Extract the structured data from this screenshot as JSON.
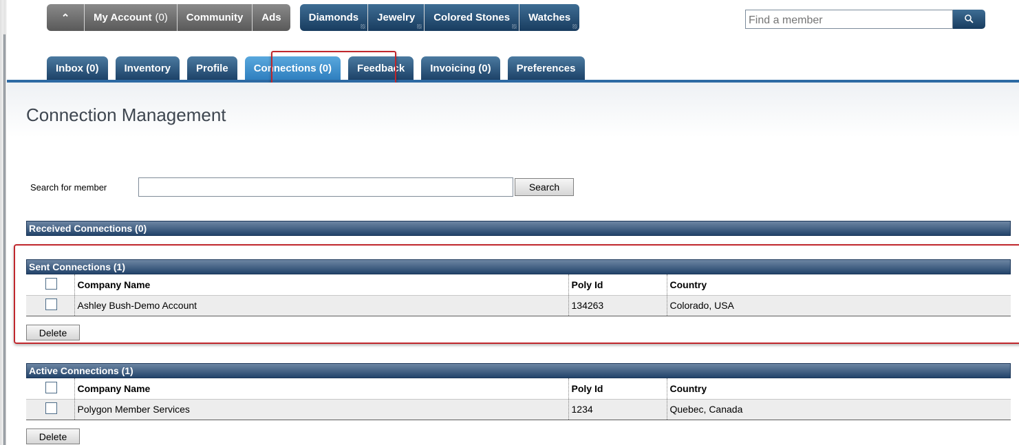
{
  "top_nav": {
    "home_icon": "home-icon",
    "my_account_label": "My Account",
    "my_account_count": "(0)",
    "community_label": "Community",
    "ads_label": "Ads",
    "diamonds_label": "Diamonds",
    "jewelry_label": "Jewelry",
    "colored_stones_label": "Colored Stones",
    "watches_label": "Watches",
    "member_search_placeholder": "Find a member",
    "search_icon": "search-icon"
  },
  "sub_tabs": [
    {
      "label": "Inbox (0)"
    },
    {
      "label": "Inventory"
    },
    {
      "label": "Profile"
    },
    {
      "label": "Connections (0)",
      "active": true
    },
    {
      "label": "Feedback"
    },
    {
      "label": "Invoicing (0)"
    },
    {
      "label": "Preferences"
    }
  ],
  "page": {
    "title": "Connection Management",
    "search_label": "Search for member",
    "search_value": "",
    "search_button": "Search"
  },
  "received": {
    "title": "Received Connections (0)"
  },
  "sent": {
    "title": "Sent Connections (1)",
    "headers": [
      "Company Name",
      "Poly Id",
      "Country"
    ],
    "rows": [
      {
        "company": "Ashley Bush-Demo Account",
        "poly_id": "134263",
        "country": "Colorado, USA"
      }
    ],
    "delete_label": "Delete"
  },
  "active": {
    "title": "Active Connections (1)",
    "headers": [
      "Company Name",
      "Poly Id",
      "Country"
    ],
    "rows": [
      {
        "company": "Polygon Member Services",
        "poly_id": "1234",
        "country": "Quebec, Canada"
      }
    ],
    "delete_label": "Delete"
  },
  "colors": {
    "nav_blue": "#1d4268",
    "nav_gray": "#595959",
    "active_tab": "#2f7fbf",
    "highlight_red": "#c0262c"
  }
}
